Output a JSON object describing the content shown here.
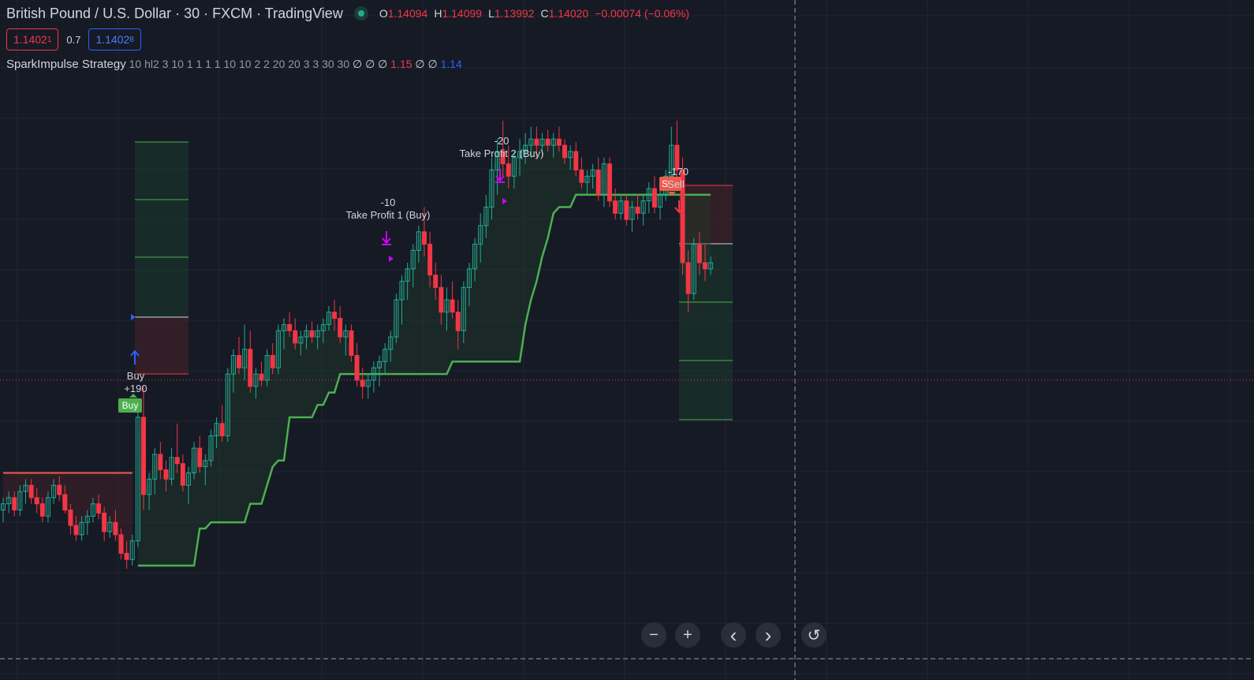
{
  "header": {
    "symbol_title": "British Pound / U.S. Dollar · 30 · FXCM · TradingView",
    "ohlc": [
      {
        "key": "O",
        "value": "1.14094"
      },
      {
        "key": "H",
        "value": "1.14099"
      },
      {
        "key": "L",
        "value": "1.13992"
      },
      {
        "key": "C",
        "value": "1.14020"
      }
    ],
    "change": "−0.00074 (−0.06%)"
  },
  "quote": {
    "sell_price": "1.1402",
    "sell_price_sup": "1",
    "spread": "0.7",
    "buy_price": "1.1402",
    "buy_price_sup": "8"
  },
  "indicator": {
    "name": "SparkImpulse Strategy",
    "params": "10 hl2 3 10 1 1 1 1 10 10 2 2 20 20 3 3 30 30",
    "nulls_a": "∅ ∅ ∅",
    "value_red": "1.15",
    "nulls_b": "∅ ∅",
    "value_blue": "1.14"
  },
  "annotations": {
    "tp1_value": "-10",
    "tp1_label": "Take Profit 1 (Buy)",
    "tp2_value": "-20",
    "tp2_label": "Take Profit 2 (Buy)",
    "buy_label": "Buy",
    "buy_value": "+190",
    "buy_badge": "Buy",
    "sell_value": "-170",
    "sell_label": "Sell",
    "sell_badge": "S"
  },
  "controls": {
    "zoom_out": "−",
    "zoom_in": "+",
    "scroll_left": "‹",
    "scroll_right": "›",
    "reset": "↺"
  },
  "colors": {
    "background": "#161a25",
    "grid": "#232734",
    "up": "#22ab94",
    "down": "#f23645",
    "trail_up": "#4caf50",
    "trail_down": "#f05a4e",
    "marker": "#d500f9",
    "buy": "#2962ff"
  },
  "chart_data": {
    "type": "candlestick",
    "title": "British Pound / U.S. Dollar · 30 · FXCM",
    "y_range": [
      1.1305,
      1.1525
    ],
    "candles": [
      [
        1.136,
        1.1364,
        1.1356,
        1.1362
      ],
      [
        1.1362,
        1.1366,
        1.1359,
        1.1364
      ],
      [
        1.1364,
        1.1366,
        1.1358,
        1.136
      ],
      [
        1.136,
        1.1368,
        1.1358,
        1.1366
      ],
      [
        1.1366,
        1.137,
        1.1362,
        1.1368
      ],
      [
        1.1368,
        1.137,
        1.1362,
        1.1364
      ],
      [
        1.1364,
        1.1367,
        1.1359,
        1.1362
      ],
      [
        1.1362,
        1.1364,
        1.1356,
        1.1358
      ],
      [
        1.1358,
        1.1366,
        1.1356,
        1.1364
      ],
      [
        1.1364,
        1.137,
        1.1362,
        1.1368
      ],
      [
        1.1368,
        1.1371,
        1.1363,
        1.1365
      ],
      [
        1.1365,
        1.1368,
        1.1359,
        1.136
      ],
      [
        1.136,
        1.1362,
        1.1352,
        1.1355
      ],
      [
        1.1355,
        1.1358,
        1.135,
        1.1352
      ],
      [
        1.1352,
        1.1358,
        1.135,
        1.1356
      ],
      [
        1.1356,
        1.136,
        1.1352,
        1.1358
      ],
      [
        1.1358,
        1.1364,
        1.1356,
        1.1362
      ],
      [
        1.1362,
        1.1365,
        1.1357,
        1.1359
      ],
      [
        1.1359,
        1.1361,
        1.135,
        1.1353
      ],
      [
        1.1353,
        1.1358,
        1.1351,
        1.1356
      ],
      [
        1.1356,
        1.136,
        1.135,
        1.1352
      ],
      [
        1.1352,
        1.1354,
        1.1344,
        1.1346
      ],
      [
        1.1346,
        1.135,
        1.1341,
        1.1344
      ],
      [
        1.1344,
        1.1352,
        1.1342,
        1.135
      ],
      [
        1.135,
        1.1395,
        1.1348,
        1.139
      ],
      [
        1.139,
        1.14,
        1.136,
        1.1365
      ],
      [
        1.1365,
        1.1372,
        1.136,
        1.137
      ],
      [
        1.137,
        1.138,
        1.1365,
        1.1378
      ],
      [
        1.1378,
        1.1382,
        1.137,
        1.1373
      ],
      [
        1.1373,
        1.1376,
        1.1366,
        1.137
      ],
      [
        1.137,
        1.138,
        1.1368,
        1.1377
      ],
      [
        1.1377,
        1.1388,
        1.1372,
        1.1375
      ],
      [
        1.1375,
        1.1378,
        1.1366,
        1.1368
      ],
      [
        1.1368,
        1.1374,
        1.1362,
        1.1372
      ],
      [
        1.1372,
        1.1382,
        1.137,
        1.138
      ],
      [
        1.138,
        1.1384,
        1.1372,
        1.1374
      ],
      [
        1.1374,
        1.1378,
        1.1368,
        1.1376
      ],
      [
        1.1376,
        1.1386,
        1.1374,
        1.1384
      ],
      [
        1.1384,
        1.139,
        1.138,
        1.1388
      ],
      [
        1.1388,
        1.1394,
        1.1382,
        1.1384
      ],
      [
        1.1384,
        1.1406,
        1.1382,
        1.1404
      ],
      [
        1.1404,
        1.1412,
        1.1398,
        1.141
      ],
      [
        1.141,
        1.1416,
        1.1404,
        1.1406
      ],
      [
        1.1406,
        1.142,
        1.1402,
        1.1412
      ],
      [
        1.1412,
        1.1418,
        1.1398,
        1.14
      ],
      [
        1.14,
        1.1406,
        1.1396,
        1.1404
      ],
      [
        1.1404,
        1.1408,
        1.14,
        1.1402
      ],
      [
        1.1402,
        1.1412,
        1.14,
        1.141
      ],
      [
        1.141,
        1.1414,
        1.1404,
        1.1406
      ],
      [
        1.1406,
        1.142,
        1.1404,
        1.1418
      ],
      [
        1.1418,
        1.1422,
        1.1412,
        1.142
      ],
      [
        1.142,
        1.1424,
        1.1416,
        1.1418
      ],
      [
        1.1418,
        1.1422,
        1.1412,
        1.1414
      ],
      [
        1.1414,
        1.1418,
        1.141,
        1.1416
      ],
      [
        1.1416,
        1.142,
        1.1412,
        1.1418
      ],
      [
        1.1418,
        1.1421,
        1.1414,
        1.1416
      ],
      [
        1.1416,
        1.142,
        1.1412,
        1.1418
      ],
      [
        1.1418,
        1.1422,
        1.1414,
        1.142
      ],
      [
        1.142,
        1.1426,
        1.1418,
        1.1424
      ],
      [
        1.1424,
        1.1428,
        1.1418,
        1.1422
      ],
      [
        1.1422,
        1.1426,
        1.1414,
        1.1416
      ],
      [
        1.1416,
        1.142,
        1.141,
        1.1418
      ],
      [
        1.1418,
        1.142,
        1.1408,
        1.141
      ],
      [
        1.141,
        1.1414,
        1.14,
        1.1402
      ],
      [
        1.1402,
        1.1406,
        1.1396,
        1.14
      ],
      [
        1.14,
        1.1404,
        1.1396,
        1.1402
      ],
      [
        1.1402,
        1.1408,
        1.1398,
        1.1406
      ],
      [
        1.1406,
        1.141,
        1.14,
        1.1408
      ],
      [
        1.1408,
        1.1414,
        1.1404,
        1.1412
      ],
      [
        1.1412,
        1.1418,
        1.1408,
        1.1416
      ],
      [
        1.1416,
        1.143,
        1.1414,
        1.1428
      ],
      [
        1.1428,
        1.1436,
        1.142,
        1.1434
      ],
      [
        1.1434,
        1.144,
        1.1428,
        1.1438
      ],
      [
        1.1438,
        1.1446,
        1.1432,
        1.1444
      ],
      [
        1.1444,
        1.1452,
        1.144,
        1.145
      ],
      [
        1.145,
        1.1458,
        1.1442,
        1.1446
      ],
      [
        1.1446,
        1.145,
        1.1432,
        1.1436
      ],
      [
        1.1436,
        1.144,
        1.1428,
        1.1432
      ],
      [
        1.1432,
        1.1436,
        1.142,
        1.1424
      ],
      [
        1.1424,
        1.1432,
        1.1418,
        1.1428
      ],
      [
        1.1428,
        1.1434,
        1.1422,
        1.1424
      ],
      [
        1.1424,
        1.1428,
        1.1412,
        1.1418
      ],
      [
        1.1418,
        1.1434,
        1.1414,
        1.1432
      ],
      [
        1.1432,
        1.144,
        1.1426,
        1.1438
      ],
      [
        1.1438,
        1.1448,
        1.1434,
        1.1446
      ],
      [
        1.1446,
        1.1456,
        1.144,
        1.1452
      ],
      [
        1.1452,
        1.1462,
        1.1448,
        1.1458
      ],
      [
        1.1458,
        1.1474,
        1.1454,
        1.147
      ],
      [
        1.147,
        1.148,
        1.1462,
        1.1476
      ],
      [
        1.1476,
        1.1486,
        1.1468,
        1.1472
      ],
      [
        1.1472,
        1.1478,
        1.1464,
        1.1468
      ],
      [
        1.1468,
        1.1476,
        1.1464,
        1.1474
      ],
      [
        1.1474,
        1.148,
        1.1468,
        1.1476
      ],
      [
        1.1476,
        1.1482,
        1.1472,
        1.1478
      ],
      [
        1.1478,
        1.1484,
        1.1474,
        1.148
      ],
      [
        1.148,
        1.1484,
        1.1474,
        1.1478
      ],
      [
        1.1478,
        1.1482,
        1.1474,
        1.148
      ],
      [
        1.148,
        1.1483,
        1.1476,
        1.1478
      ],
      [
        1.1478,
        1.1482,
        1.1474,
        1.148
      ],
      [
        1.148,
        1.1484,
        1.1476,
        1.1478
      ],
      [
        1.1478,
        1.148,
        1.1472,
        1.1474
      ],
      [
        1.1474,
        1.1478,
        1.147,
        1.1476
      ],
      [
        1.1476,
        1.1479,
        1.1468,
        1.147
      ],
      [
        1.147,
        1.1474,
        1.1464,
        1.1466
      ],
      [
        1.1466,
        1.147,
        1.1462,
        1.1468
      ],
      [
        1.1468,
        1.1472,
        1.1464,
        1.147
      ],
      [
        1.147,
        1.1474,
        1.146,
        1.1462
      ],
      [
        1.1462,
        1.1474,
        1.1458,
        1.1472
      ],
      [
        1.1472,
        1.1474,
        1.1458,
        1.146
      ],
      [
        1.146,
        1.1464,
        1.1454,
        1.1456
      ],
      [
        1.1456,
        1.1462,
        1.1454,
        1.146
      ],
      [
        1.146,
        1.1462,
        1.1452,
        1.1454
      ],
      [
        1.1454,
        1.146,
        1.145,
        1.1458
      ],
      [
        1.1458,
        1.1462,
        1.1454,
        1.1456
      ],
      [
        1.1456,
        1.1462,
        1.1452,
        1.146
      ],
      [
        1.146,
        1.1466,
        1.1456,
        1.1464
      ],
      [
        1.1464,
        1.1468,
        1.1456,
        1.1458
      ],
      [
        1.1458,
        1.1464,
        1.1454,
        1.1462
      ],
      [
        1.1462,
        1.147,
        1.146,
        1.1468
      ],
      [
        1.1468,
        1.1484,
        1.1464,
        1.1478
      ],
      [
        1.1478,
        1.1486,
        1.1466,
        1.147
      ],
      [
        1.147,
        1.1474,
        1.1436,
        1.144
      ],
      [
        1.144,
        1.1444,
        1.1424,
        1.143
      ],
      [
        1.143,
        1.1448,
        1.1428,
        1.1446
      ],
      [
        1.1446,
        1.145,
        1.1436,
        1.144
      ],
      [
        1.144,
        1.1446,
        1.1434,
        1.1438
      ],
      [
        1.1438,
        1.1442,
        1.1436,
        1.144
      ]
    ]
  }
}
